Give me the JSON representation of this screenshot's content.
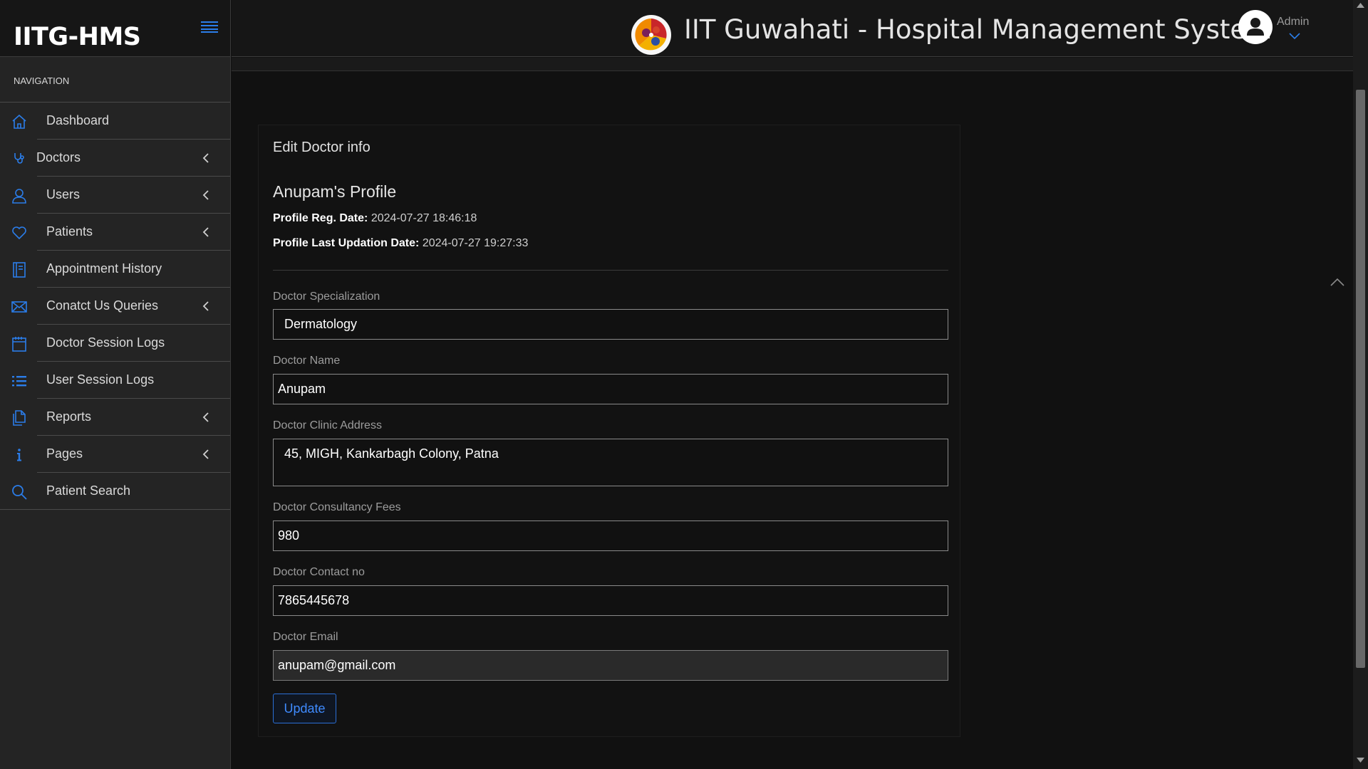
{
  "brand": {
    "name": "IITG-HMS"
  },
  "header": {
    "title": "IIT Guwahati - Hospital Management System",
    "user_label": "Admin"
  },
  "sidebar": {
    "heading": "NAVIGATION",
    "items": [
      {
        "label": "Dashboard",
        "icon": "home-icon",
        "expandable": false
      },
      {
        "label": "Doctors",
        "icon": "stethoscope-icon",
        "expandable": true
      },
      {
        "label": "Users",
        "icon": "user-icon",
        "expandable": true
      },
      {
        "label": "Patients",
        "icon": "heart-icon",
        "expandable": true
      },
      {
        "label": "Appointment History",
        "icon": "book-icon",
        "expandable": false
      },
      {
        "label": "Conatct Us Queries",
        "icon": "envelope-icon",
        "expandable": true
      },
      {
        "label": "Doctor Session Logs",
        "icon": "calendar-icon",
        "expandable": false
      },
      {
        "label": "User Session Logs",
        "icon": "list-icon",
        "expandable": false
      },
      {
        "label": "Reports",
        "icon": "files-icon",
        "expandable": true
      },
      {
        "label": "Pages",
        "icon": "info-icon",
        "expandable": true
      },
      {
        "label": "Patient Search",
        "icon": "search-icon",
        "expandable": false
      }
    ]
  },
  "panel": {
    "heading": "Edit Doctor info",
    "profile_title": "Anupam's Profile",
    "reg_date_label": "Profile Reg. Date:",
    "reg_date_value": "2024-07-27 18:46:18",
    "update_date_label": "Profile Last Updation Date:",
    "update_date_value": "2024-07-27 19:27:33",
    "fields": {
      "specialization": {
        "label": "Doctor Specialization",
        "value": "Dermatology"
      },
      "name": {
        "label": "Doctor Name",
        "value": "Anupam"
      },
      "address": {
        "label": "Doctor Clinic Address",
        "value": "45, MIGH, Kankarbagh Colony, Patna"
      },
      "fees": {
        "label": "Doctor Consultancy Fees",
        "value": "980"
      },
      "contact": {
        "label": "Doctor Contact no",
        "value": "7865445678"
      },
      "email": {
        "label": "Doctor Email",
        "value": "anupam@gmail.com"
      }
    },
    "update_label": "Update"
  },
  "colors": {
    "accent": "#2b7de9",
    "background": "#111111",
    "sidebar": "#242424"
  }
}
